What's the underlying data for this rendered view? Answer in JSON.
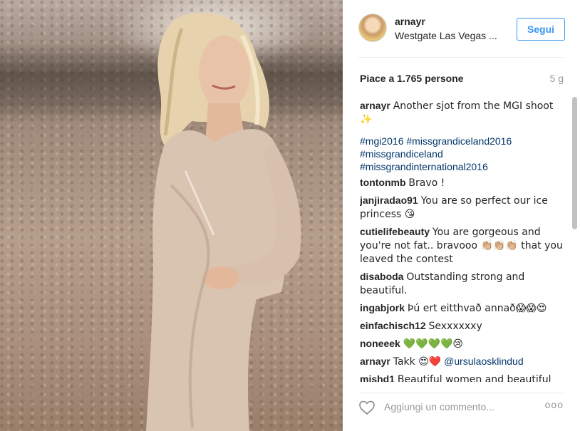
{
  "post": {
    "username": "arnayr",
    "location": "Westgate Las Vegas ...",
    "follow_label": "Segui",
    "likes": "Piace a 1.765 persone",
    "age": "5 g"
  },
  "caption": {
    "user": "arnayr",
    "text": "Another sjot from the MGI shoot ✨",
    "tags_line1": "#mgi2016 #missgrandiceland2016",
    "tags_line2": "#missgrandiceland",
    "tags_line3": "#missgrandinternational2016"
  },
  "comments": [
    {
      "user": "tontonmb",
      "text": "Bravo !"
    },
    {
      "user": "janjiradao91",
      "text": "You are so perfect our ice princess 😘"
    },
    {
      "user": "cutielifebeauty",
      "text": "You are gorgeous and you're not fat.. bravooo 👏🏼👏🏼👏🏼 that you leaved the contest"
    },
    {
      "user": "disaboda",
      "text": "Outstanding strong and beautiful."
    },
    {
      "user": "ingabjork",
      "text": "Þú ert eitthvað annað😱😱😍"
    },
    {
      "user": "einfachisch12",
      "text": "Sexxxxxxy"
    },
    {
      "user": "noneeek",
      "text": "💚💚💚💚😢"
    },
    {
      "user": "arnayr",
      "text": "Takk 😍❤️",
      "mention": "@ursulaosklindud"
    },
    {
      "user": "mishd1",
      "text": "Beautiful women and beautiful"
    }
  ],
  "bottom": {
    "comment_placeholder": "Aggiungi un commento...",
    "more_label": "ooo"
  },
  "icons": {
    "heart": "heart-outline-icon",
    "more": "more-options-icon"
  },
  "colors": {
    "link": "#003569",
    "follow": "#3897f0",
    "muted": "#999999"
  }
}
